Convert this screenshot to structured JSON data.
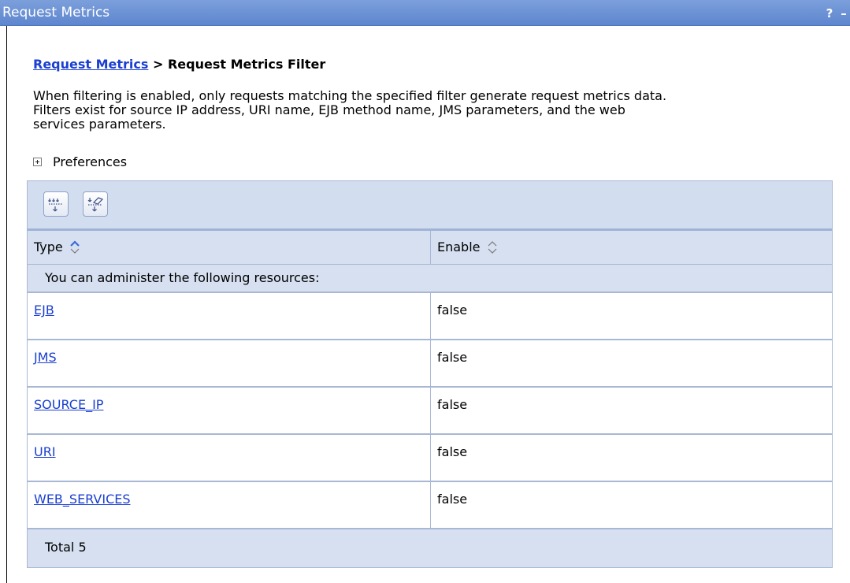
{
  "window": {
    "title": "Request Metrics",
    "help_label": "?",
    "minimize_label": "–"
  },
  "breadcrumb": {
    "link": "Request Metrics",
    "separator": " > ",
    "current": "Request Metrics Filter"
  },
  "description": {
    "line1": "When filtering is enabled, only requests matching the specified filter generate request metrics data.",
    "line2": "Filters exist for source IP address, URI name, EJB method name, JMS parameters, and the web",
    "line3": "services parameters."
  },
  "preferences": {
    "label": "Preferences"
  },
  "table": {
    "columns": [
      "Type",
      "Enable"
    ],
    "info": "You can administer the following resources:",
    "rows": [
      {
        "type": "EJB",
        "enable": "false"
      },
      {
        "type": "JMS",
        "enable": "false"
      },
      {
        "type": "SOURCE_IP",
        "enable": "false"
      },
      {
        "type": "URI",
        "enable": "false"
      },
      {
        "type": "WEB_SERVICES",
        "enable": "false"
      }
    ],
    "total": "Total 5"
  },
  "icons": {
    "toolbar": [
      "select-all-icon",
      "deselect-all-icon"
    ],
    "sort": "sort-arrows-icon",
    "expand": "expand-plus-icon"
  },
  "colors": {
    "titlebar": "#6a8fd4",
    "link": "#1a3fd1",
    "table_band": "#d6e0f0",
    "border": "#a8b8d4"
  }
}
